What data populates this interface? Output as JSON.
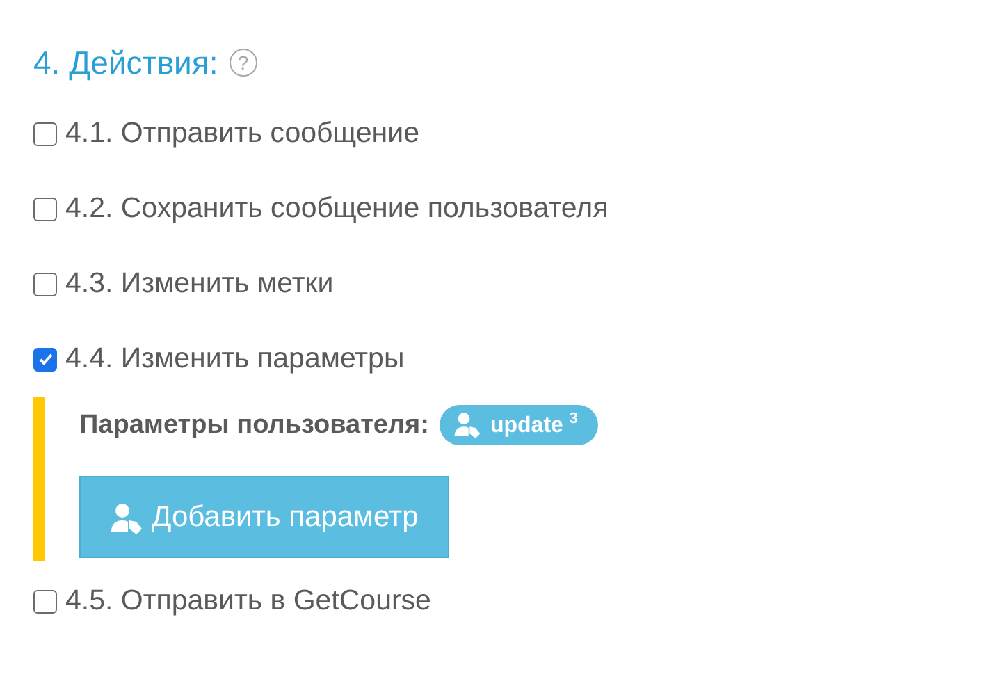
{
  "section": {
    "title": "4. Действия:",
    "help_icon": "?"
  },
  "actions": [
    {
      "label": "4.1. Отправить сообщение",
      "checked": false
    },
    {
      "label": "4.2. Сохранить сообщение пользователя",
      "checked": false
    },
    {
      "label": "4.3. Изменить метки",
      "checked": false
    },
    {
      "label": "4.4. Изменить параметры",
      "checked": true,
      "params": {
        "label": "Параметры пользователя:",
        "badge": "update $^{3}$",
        "button": "Добавить параметр"
      }
    },
    {
      "label": "4.5. Отправить в GetCourse",
      "checked": false
    }
  ]
}
